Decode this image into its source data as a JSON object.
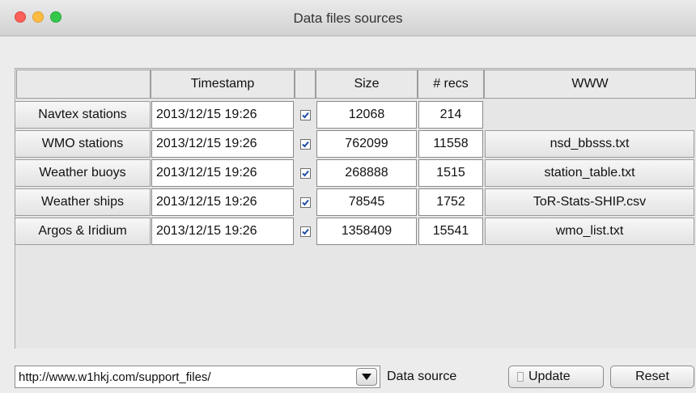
{
  "window": {
    "title": "Data files sources"
  },
  "table": {
    "headers": {
      "timestamp": "Timestamp",
      "size": "Size",
      "recs": "# recs",
      "www": "WWW"
    },
    "rows": [
      {
        "name": "Navtex stations",
        "timestamp": "2013/12/15 19:26",
        "checked": true,
        "size": "12068",
        "recs": "214",
        "www": ""
      },
      {
        "name": "WMO stations",
        "timestamp": "2013/12/15 19:26",
        "checked": true,
        "size": "762099",
        "recs": "11558",
        "www": "nsd_bbsss.txt"
      },
      {
        "name": "Weather buoys",
        "timestamp": "2013/12/15 19:26",
        "checked": true,
        "size": "268888",
        "recs": "1515",
        "www": "station_table.txt"
      },
      {
        "name": "Weather ships",
        "timestamp": "2013/12/15 19:26",
        "checked": true,
        "size": "78545",
        "recs": "1752",
        "www": "ToR-Stats-SHIP.csv"
      },
      {
        "name": "Argos & Iridium",
        "timestamp": "2013/12/15 19:26",
        "checked": true,
        "size": "1358409",
        "recs": "15541",
        "www": "wmo_list.txt"
      }
    ]
  },
  "source": {
    "url": "http://www.w1hkj.com/support_files/",
    "label": "Data source"
  },
  "buttons": {
    "update": "Update",
    "reset": "Reset"
  },
  "colors": {
    "checkmark": "#1f4fa8"
  }
}
